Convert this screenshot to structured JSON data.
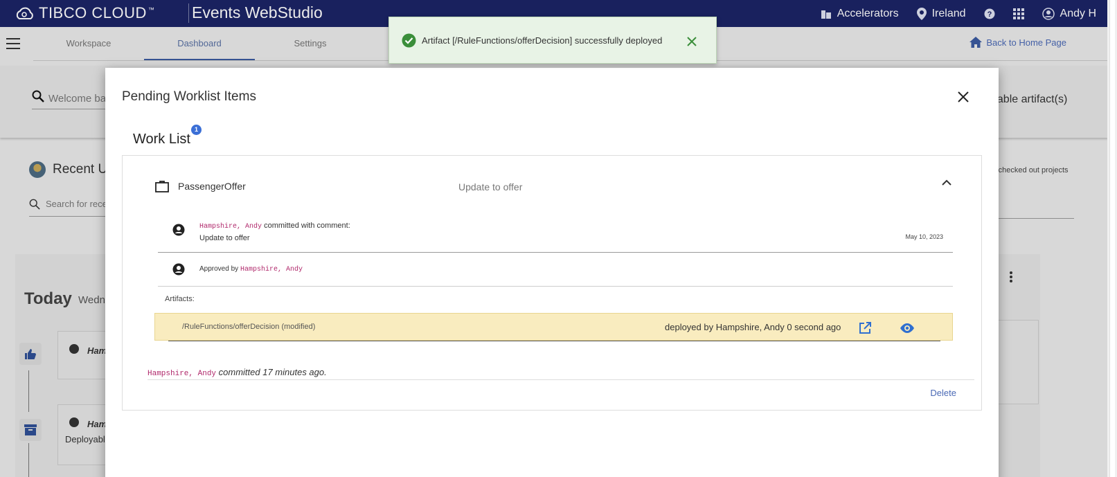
{
  "topbar": {
    "brand": "TIBCO CLOUD",
    "brand_tm": "™",
    "app_title": "Events WebStudio",
    "accelerators": "Accelerators",
    "region": "Ireland",
    "user": "Andy H"
  },
  "subnav": {
    "tabs": [
      "Workspace",
      "Dashboard",
      "Settings"
    ],
    "active_tab": "Dashboard",
    "back_home": "Back to Home Page"
  },
  "background": {
    "welcome_placeholder": "Welcome ba",
    "deployable_text": "oyable artifact(s)",
    "recent_label": "Recent U",
    "checked_out_text": "-checked out projects",
    "search_recent_placeholder": "Search for rece",
    "today_label": "Today",
    "today_day": "Wedn",
    "card1_name": "Ham",
    "card2_name": "Ham",
    "card2_text": "Deployabl"
  },
  "modal": {
    "title": "Pending Worklist Items",
    "worklist_title": "Work List",
    "worklist_count": "1",
    "project_name": "PassengerOffer",
    "project_desc": "Update to offer",
    "commit": {
      "user": "Hampshire, Andy",
      "action": "committed with comment:",
      "comment": "Update to offer",
      "date": "May 10, 2023"
    },
    "approval": {
      "prefix": "Approved by",
      "user": "Hampshire, Andy"
    },
    "artifacts_label": "Artifacts:",
    "artifact": {
      "path": "/RuleFunctions/offerDecision (modified)",
      "status": "deployed by Hampshire, Andy 0 second ago"
    },
    "committed_user": "Hampshire, Andy",
    "committed_ago": "committed 17 minutes ago.",
    "delete_label": "Delete"
  },
  "toast": {
    "message": "Artifact [/RuleFunctions/offerDecision] successfully deployed"
  },
  "colors": {
    "topbar": "#1c2467",
    "accent": "#4a69b5",
    "artifact_highlight": "#f9ecbf",
    "toast_bg": "#e8f3e6",
    "success": "#3a8e3a",
    "user_mono": "#b0286b"
  }
}
